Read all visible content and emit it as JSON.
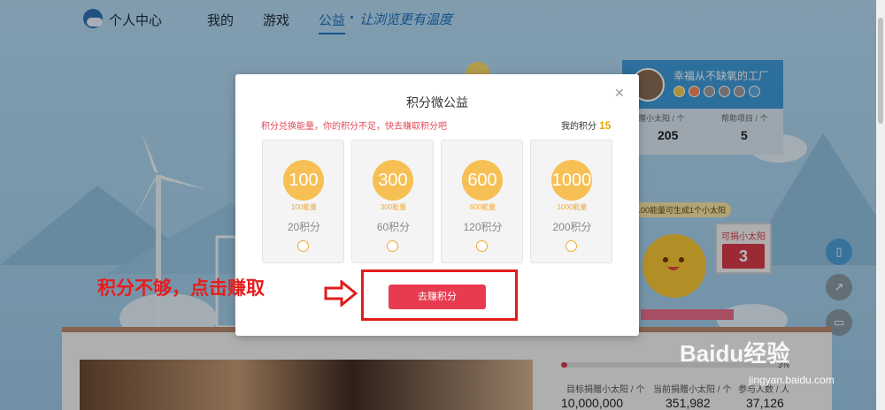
{
  "nav": {
    "title": "个人中心",
    "items": [
      {
        "label": "我的"
      },
      {
        "label": "游戏"
      },
      {
        "label": "公益"
      }
    ],
    "slogan": "让浏览更有温度"
  },
  "profile": {
    "name": "幸福从不缺氧的工厂",
    "stats": [
      {
        "label": "共捐赠小太阳 / 个",
        "value": "205"
      },
      {
        "label": "帮助项目 / 个",
        "value": "5"
      }
    ],
    "tip": "100能量可生成1个小太阳",
    "sign_label": "可捐小太阳",
    "sign_value": "3"
  },
  "modal": {
    "title": "积分微公益",
    "notice": "积分兑换能量，你的积分不足，快去赚取积分吧",
    "points_label": "我的积分",
    "points_value": "15",
    "options": [
      {
        "amount": "100",
        "energy": "100能量",
        "cost": "20积分"
      },
      {
        "amount": "300",
        "energy": "300能量",
        "cost": "60积分"
      },
      {
        "amount": "600",
        "energy": "600能量",
        "cost": "120积分"
      },
      {
        "amount": "1000",
        "energy": "1000能量",
        "cost": "200积分"
      }
    ],
    "earn_button": "去赚积分"
  },
  "annotation": "积分不够，点击赚取",
  "project": {
    "progress_fraction": 0.03,
    "progress_label": "3%",
    "stats": [
      {
        "label": "目标捐赠小太阳 / 个",
        "value": "10,000,000"
      },
      {
        "label": "当前捐赠小太阳 / 个",
        "value": "351,982"
      },
      {
        "label": "参与人数 / 人",
        "value": "37,126"
      }
    ]
  },
  "watermark": {
    "text": "Baidu经验",
    "sub": "jingyan.baidu.com"
  },
  "colors": {
    "accent_blue": "#1e73be",
    "button_red": "#e83b4f",
    "annotation_red": "#e61d1d",
    "gold": "#f7c055"
  },
  "icons": [
    "logo-icon",
    "close-icon",
    "bookmark-icon",
    "share-icon",
    "comment-icon",
    "arrow-right-icon"
  ]
}
